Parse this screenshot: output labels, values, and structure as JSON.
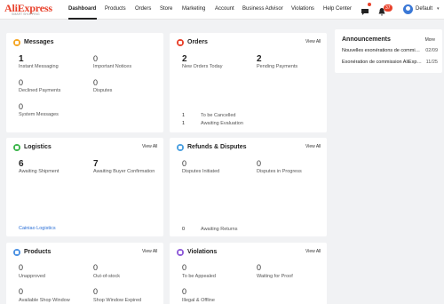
{
  "brand": {
    "name": "AliExpress",
    "subtitle": "SMART SHOPPING"
  },
  "nav": [
    {
      "label": "Dashboard"
    },
    {
      "label": "Products"
    },
    {
      "label": "Orders"
    },
    {
      "label": "Store"
    },
    {
      "label": "Marketing"
    },
    {
      "label": "Account"
    },
    {
      "label": "Business Advisor"
    },
    {
      "label": "Violations"
    },
    {
      "label": "Help Center"
    }
  ],
  "header": {
    "notification_count": "37",
    "user_name": "Default"
  },
  "messages": {
    "title": "Messages",
    "items": [
      {
        "value": "1",
        "label": "Instant Messaging"
      },
      {
        "value": "0",
        "label": "Important Notices"
      },
      {
        "value": "0",
        "label": "Declined Payments"
      },
      {
        "value": "0",
        "label": "Disputes"
      },
      {
        "value": "0",
        "label": "System Messages"
      }
    ]
  },
  "orders": {
    "title": "Orders",
    "view_all": "View All",
    "items": [
      {
        "value": "2",
        "label": "New Orders Today"
      },
      {
        "value": "2",
        "label": "Pending Payments"
      }
    ],
    "small": [
      {
        "value": "1",
        "label": "To be Cancelled"
      },
      {
        "value": "1",
        "label": "Awaiting Evaluation"
      }
    ]
  },
  "announcements": {
    "title": "Announcements",
    "more": "More",
    "items": [
      {
        "text": "Nouvelles exonérations de commission",
        "date": "02/09"
      },
      {
        "text": "Exonération de commission AliExpress",
        "date": "11/25"
      }
    ]
  },
  "logistics": {
    "title": "Logistics",
    "view_all": "View All",
    "items": [
      {
        "value": "6",
        "label": "Awaiting Shipment"
      },
      {
        "value": "7",
        "label": "Awaiting Buyer Confirmation"
      }
    ],
    "link": "Cainiao Logistics"
  },
  "refunds": {
    "title": "Refunds & Disputes",
    "view_all": "View All",
    "items": [
      {
        "value": "0",
        "label": "Disputes Initiated"
      },
      {
        "value": "0",
        "label": "Disputes in Progress"
      }
    ],
    "small": [
      {
        "value": "0",
        "label": "Awaiting Returns"
      }
    ]
  },
  "products": {
    "title": "Products",
    "view_all": "View All",
    "items": [
      {
        "value": "0",
        "label": "Unapproved"
      },
      {
        "value": "0",
        "label": "Out-of-stock"
      },
      {
        "value": "0",
        "label": "Available Shop Window"
      },
      {
        "value": "0",
        "label": "Shop Window Expired"
      }
    ]
  },
  "violations": {
    "title": "Violations",
    "view_all": "View All",
    "items": [
      {
        "value": "0",
        "label": "To be Appealed"
      },
      {
        "value": "0",
        "label": "Waiting for Proof"
      },
      {
        "value": "0",
        "label": "Illegal & Offline"
      }
    ]
  },
  "colors": {
    "brand": "#e8412b",
    "messages_icon": "#f5a623",
    "orders_icon": "#e8412b",
    "logistics_icon": "#3bb54a",
    "refunds_icon": "#4a9fe0",
    "products_icon": "#4a90e2",
    "violations_icon": "#8e5bd8",
    "link": "#2a6fd6"
  }
}
